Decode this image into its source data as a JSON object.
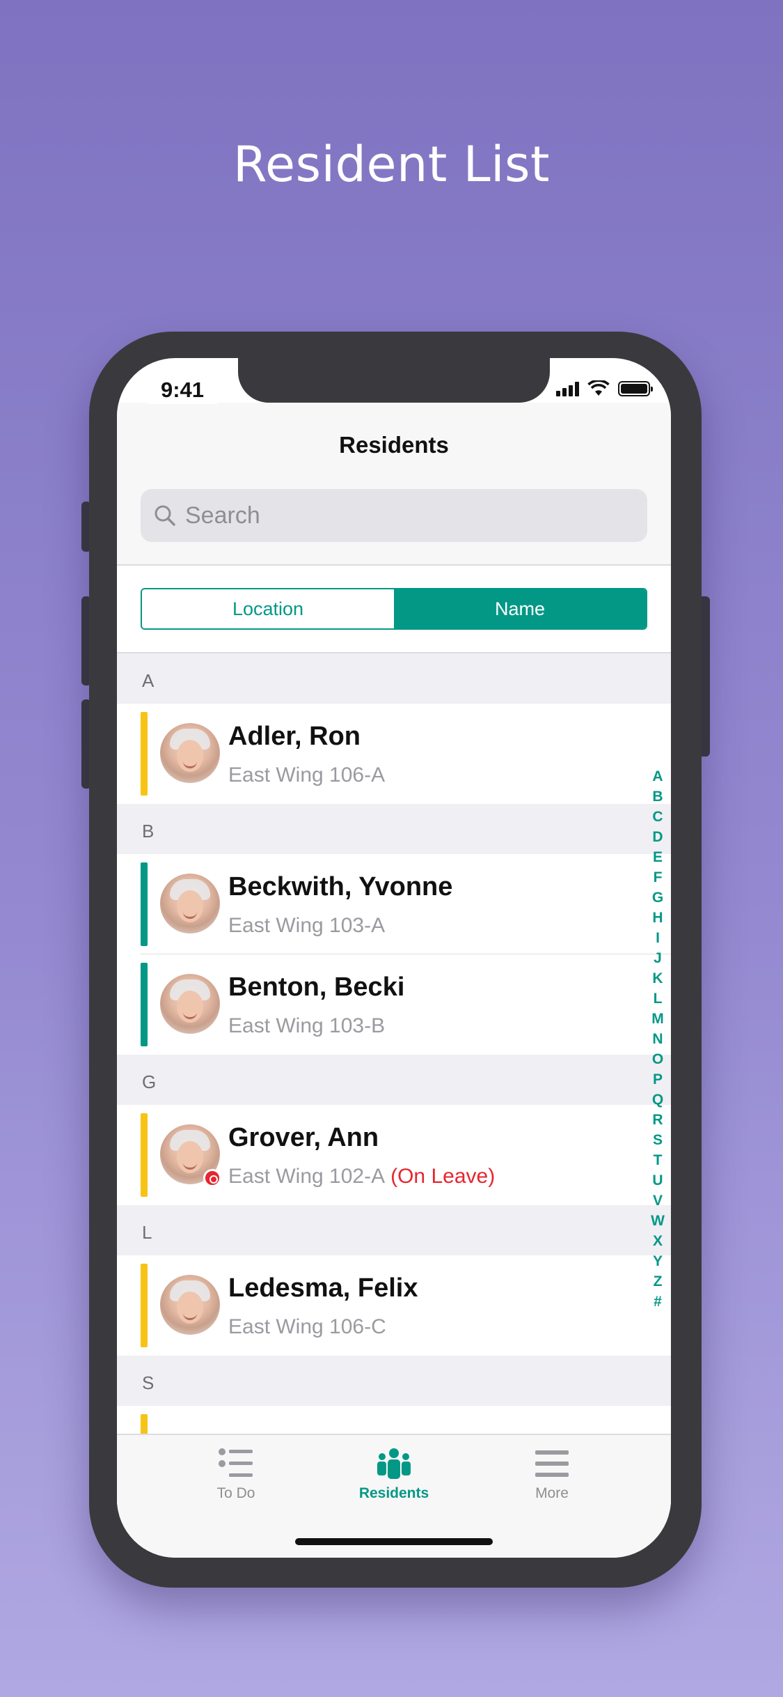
{
  "headline": "Resident List",
  "status_bar": {
    "time": "9:41"
  },
  "nav": {
    "title": "Residents",
    "search_placeholder": "Search"
  },
  "segment": {
    "options": [
      "Location",
      "Name"
    ],
    "selected": "Name"
  },
  "colors": {
    "accent": "#039886",
    "yellow_bar": "#f7c316",
    "teal_bar": "#039886",
    "leave_red": "#e5262f"
  },
  "sections": [
    {
      "letter": "A",
      "residents": [
        {
          "name": "Adler, Ron",
          "location": "East Wing 106-A",
          "bar": "yellow"
        }
      ]
    },
    {
      "letter": "B",
      "residents": [
        {
          "name": "Beckwith, Yvonne",
          "location": "East Wing 103-A",
          "bar": "teal"
        },
        {
          "name": "Benton, Becki",
          "location": "East Wing 103-B",
          "bar": "teal"
        }
      ]
    },
    {
      "letter": "G",
      "residents": [
        {
          "name": "Grover, Ann",
          "location": "East Wing 102-A",
          "status": "(On Leave)",
          "bar": "yellow"
        }
      ]
    },
    {
      "letter": "L",
      "residents": [
        {
          "name": "Ledesma, Felix",
          "location": "East Wing 106-C",
          "bar": "yellow"
        }
      ]
    },
    {
      "letter": "S",
      "residents": []
    }
  ],
  "index_letters": [
    "A",
    "B",
    "C",
    "D",
    "E",
    "F",
    "G",
    "H",
    "I",
    "J",
    "K",
    "L",
    "M",
    "N",
    "O",
    "P",
    "Q",
    "R",
    "S",
    "T",
    "U",
    "V",
    "W",
    "X",
    "Y",
    "Z",
    "#"
  ],
  "tabs": [
    {
      "label": "To Do",
      "icon": "list-icon",
      "active": false
    },
    {
      "label": "Residents",
      "icon": "residents-icon",
      "active": true
    },
    {
      "label": "More",
      "icon": "menu-icon",
      "active": false
    }
  ]
}
